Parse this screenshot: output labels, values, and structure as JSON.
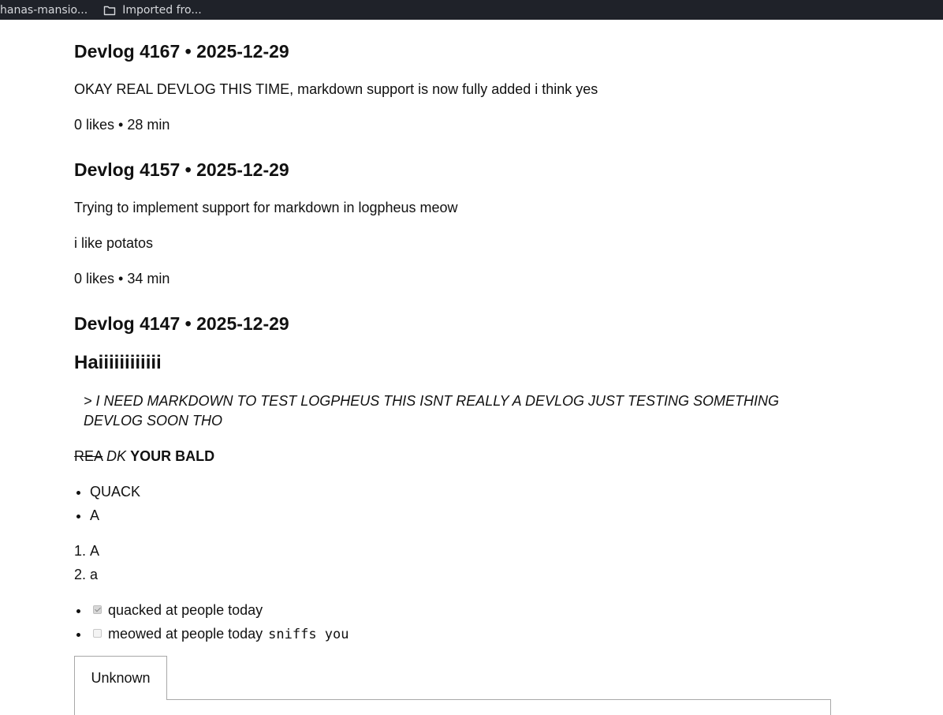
{
  "bookmarks_bar": {
    "items": [
      {
        "label": "hanas-mansio..."
      },
      {
        "label": "Imported fro...",
        "icon": "folder-icon"
      }
    ]
  },
  "devlogs": [
    {
      "title": "Devlog 4167 • 2025-12-29",
      "body": [
        "OKAY REAL DEVLOG THIS TIME, markdown support is now fully added i think yes"
      ],
      "meta": "0 likes • 28 min"
    },
    {
      "title": "Devlog 4157 • 2025-12-29",
      "body": [
        "Trying to implement support for markdown in logpheus meow",
        "i like potatos"
      ],
      "meta": "0 likes • 34 min"
    },
    {
      "title": "Devlog 4147 • 2025-12-29",
      "heading": "Haiiiiiiiiiiii",
      "quote": "> I NEED MARKDOWN TO TEST LOGPHEUS THIS ISNT REALLY A DEVLOG JUST TESTING SOMETHING DEVLOG SOON THO",
      "mixed": {
        "strike": "REA",
        "italic": "DK",
        "bold": "YOUR BALD"
      },
      "bullets": [
        "QUACK",
        "A"
      ],
      "numbered": [
        "A",
        "a"
      ],
      "tasks": [
        {
          "label": "quacked at people today",
          "checked": true
        },
        {
          "label": "meowed at people today",
          "checked": false,
          "code": "sniffs you"
        }
      ],
      "tab_label": "Unknown"
    }
  ]
}
